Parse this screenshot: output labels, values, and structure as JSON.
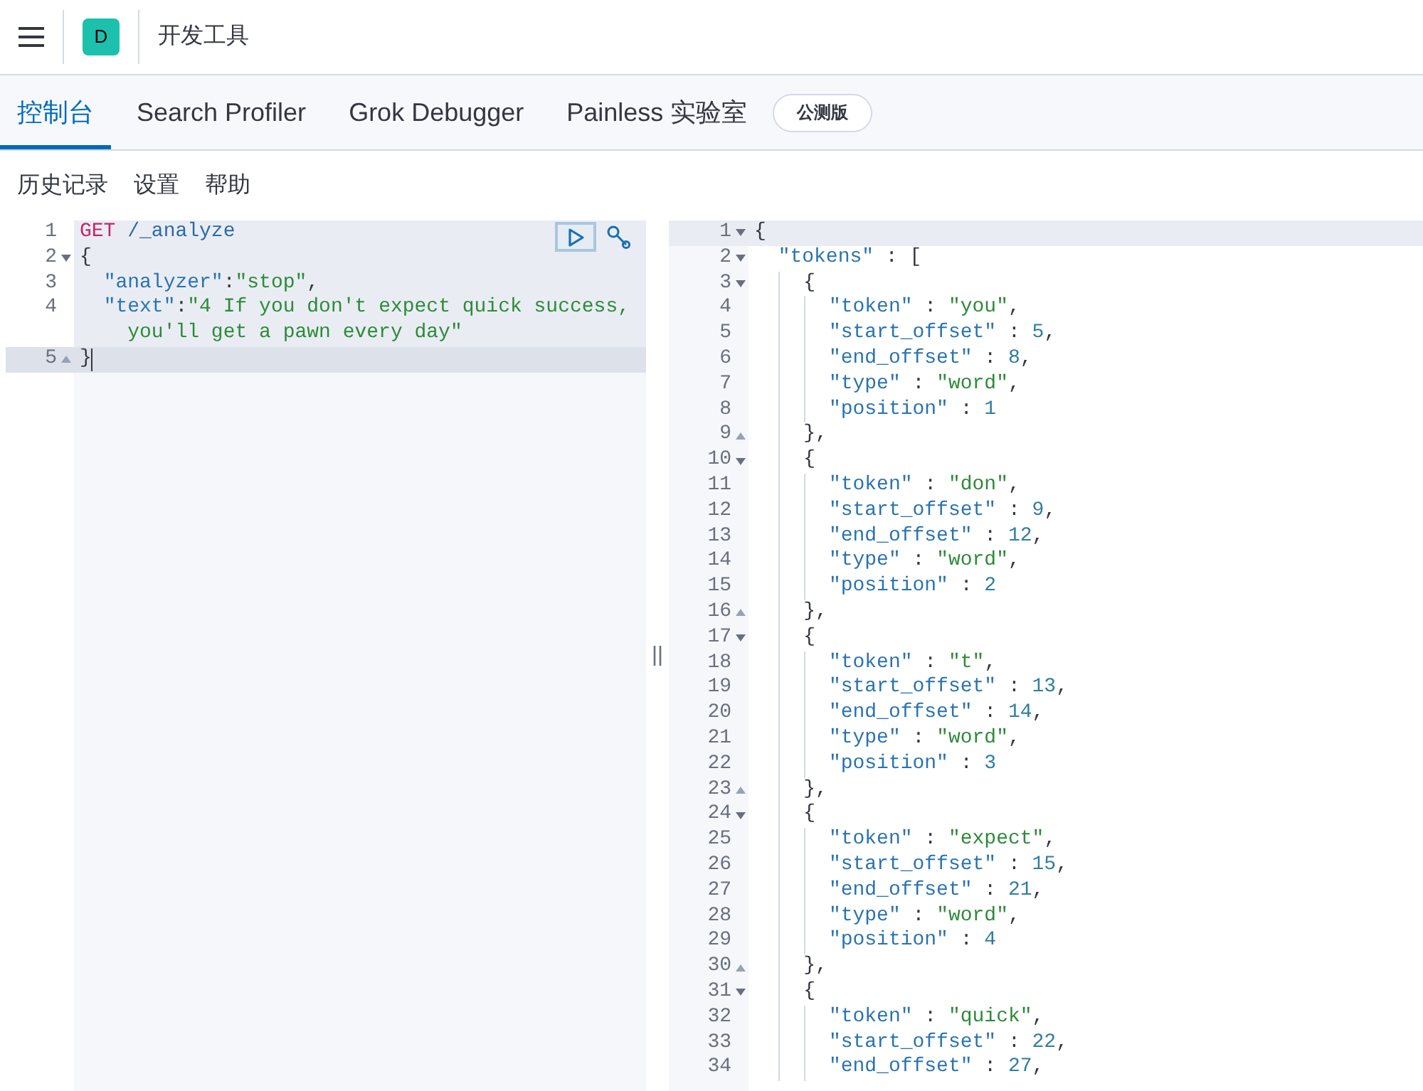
{
  "header": {
    "avatar": "D",
    "title": "开发工具"
  },
  "tabs": [
    {
      "label": "控制台",
      "selected": true
    },
    {
      "label": "Search Profiler",
      "selected": false
    },
    {
      "label": "Grok Debugger",
      "selected": false
    },
    {
      "label": "Painless 实验室",
      "selected": false,
      "badge": "公测版"
    }
  ],
  "toolbar": [
    "历史记录",
    "设置",
    "帮助"
  ],
  "request_editor": {
    "lines": [
      {
        "number": "1",
        "segments": [
          {
            "kind": "method",
            "text": "GET"
          },
          {
            "kind": "path",
            "text": " /_analyze"
          }
        ]
      },
      {
        "number": "2",
        "fold_start": true,
        "segments": [
          {
            "kind": "punct",
            "text": "{"
          }
        ]
      },
      {
        "number": "3",
        "segments": [
          {
            "kind": "key",
            "text": "  \"analyzer\""
          },
          {
            "kind": "punct",
            "text": ":"
          },
          {
            "kind": "string",
            "text": "\"stop\""
          },
          {
            "kind": "punct",
            "text": ","
          }
        ]
      },
      {
        "number": "4",
        "segments": [
          {
            "kind": "key",
            "text": "  \"text\""
          },
          {
            "kind": "punct",
            "text": ":"
          },
          {
            "kind": "string",
            "text": "\"4 If you don't expect quick success,"
          }
        ]
      },
      {
        "segments": [
          {
            "kind": "string",
            "text": "    you'll get a pawn every day\""
          }
        ]
      },
      {
        "number": "5",
        "fold_end": true,
        "active": true,
        "segments": [
          {
            "kind": "punct",
            "text": "}"
          }
        ]
      }
    ]
  },
  "response_editor": {
    "lines": [
      {
        "number": "1",
        "fold_start": true,
        "active": true,
        "segments": [
          {
            "kind": "punct",
            "text": "{"
          }
        ]
      },
      {
        "number": "2",
        "fold_start": true,
        "segments": [
          {
            "kind": "key",
            "text": "  \"tokens\""
          },
          {
            "kind": "punct",
            "text": " : ["
          }
        ]
      },
      {
        "number": "3",
        "fold_start": true,
        "segments": [
          {
            "kind": "punct",
            "text": "    {"
          }
        ]
      },
      {
        "number": "4",
        "segments": [
          {
            "kind": "key",
            "text": "      \"token\""
          },
          {
            "kind": "punct",
            "text": " : "
          },
          {
            "kind": "string",
            "text": "\"you\""
          },
          {
            "kind": "punct",
            "text": ","
          }
        ]
      },
      {
        "number": "5",
        "segments": [
          {
            "kind": "key",
            "text": "      \"start_offset\""
          },
          {
            "kind": "punct",
            "text": " : "
          },
          {
            "kind": "number",
            "text": "5"
          },
          {
            "kind": "punct",
            "text": ","
          }
        ]
      },
      {
        "number": "6",
        "segments": [
          {
            "kind": "key",
            "text": "      \"end_offset\""
          },
          {
            "kind": "punct",
            "text": " : "
          },
          {
            "kind": "number",
            "text": "8"
          },
          {
            "kind": "punct",
            "text": ","
          }
        ]
      },
      {
        "number": "7",
        "segments": [
          {
            "kind": "key",
            "text": "      \"type\""
          },
          {
            "kind": "punct",
            "text": " : "
          },
          {
            "kind": "string",
            "text": "\"word\""
          },
          {
            "kind": "punct",
            "text": ","
          }
        ]
      },
      {
        "number": "8",
        "segments": [
          {
            "kind": "key",
            "text": "      \"position\""
          },
          {
            "kind": "punct",
            "text": " : "
          },
          {
            "kind": "number",
            "text": "1"
          }
        ]
      },
      {
        "number": "9",
        "fold_end": true,
        "segments": [
          {
            "kind": "punct",
            "text": "    },"
          }
        ]
      },
      {
        "number": "10",
        "fold_start": true,
        "segments": [
          {
            "kind": "punct",
            "text": "    {"
          }
        ]
      },
      {
        "number": "11",
        "segments": [
          {
            "kind": "key",
            "text": "      \"token\""
          },
          {
            "kind": "punct",
            "text": " : "
          },
          {
            "kind": "string",
            "text": "\"don\""
          },
          {
            "kind": "punct",
            "text": ","
          }
        ]
      },
      {
        "number": "12",
        "segments": [
          {
            "kind": "key",
            "text": "      \"start_offset\""
          },
          {
            "kind": "punct",
            "text": " : "
          },
          {
            "kind": "number",
            "text": "9"
          },
          {
            "kind": "punct",
            "text": ","
          }
        ]
      },
      {
        "number": "13",
        "segments": [
          {
            "kind": "key",
            "text": "      \"end_offset\""
          },
          {
            "kind": "punct",
            "text": " : "
          },
          {
            "kind": "number",
            "text": "12"
          },
          {
            "kind": "punct",
            "text": ","
          }
        ]
      },
      {
        "number": "14",
        "segments": [
          {
            "kind": "key",
            "text": "      \"type\""
          },
          {
            "kind": "punct",
            "text": " : "
          },
          {
            "kind": "string",
            "text": "\"word\""
          },
          {
            "kind": "punct",
            "text": ","
          }
        ]
      },
      {
        "number": "15",
        "segments": [
          {
            "kind": "key",
            "text": "      \"position\""
          },
          {
            "kind": "punct",
            "text": " : "
          },
          {
            "kind": "number",
            "text": "2"
          }
        ]
      },
      {
        "number": "16",
        "fold_end": true,
        "segments": [
          {
            "kind": "punct",
            "text": "    },"
          }
        ]
      },
      {
        "number": "17",
        "fold_start": true,
        "segments": [
          {
            "kind": "punct",
            "text": "    {"
          }
        ]
      },
      {
        "number": "18",
        "segments": [
          {
            "kind": "key",
            "text": "      \"token\""
          },
          {
            "kind": "punct",
            "text": " : "
          },
          {
            "kind": "string",
            "text": "\"t\""
          },
          {
            "kind": "punct",
            "text": ","
          }
        ]
      },
      {
        "number": "19",
        "segments": [
          {
            "kind": "key",
            "text": "      \"start_offset\""
          },
          {
            "kind": "punct",
            "text": " : "
          },
          {
            "kind": "number",
            "text": "13"
          },
          {
            "kind": "punct",
            "text": ","
          }
        ]
      },
      {
        "number": "20",
        "segments": [
          {
            "kind": "key",
            "text": "      \"end_offset\""
          },
          {
            "kind": "punct",
            "text": " : "
          },
          {
            "kind": "number",
            "text": "14"
          },
          {
            "kind": "punct",
            "text": ","
          }
        ]
      },
      {
        "number": "21",
        "segments": [
          {
            "kind": "key",
            "text": "      \"type\""
          },
          {
            "kind": "punct",
            "text": " : "
          },
          {
            "kind": "string",
            "text": "\"word\""
          },
          {
            "kind": "punct",
            "text": ","
          }
        ]
      },
      {
        "number": "22",
        "segments": [
          {
            "kind": "key",
            "text": "      \"position\""
          },
          {
            "kind": "punct",
            "text": " : "
          },
          {
            "kind": "number",
            "text": "3"
          }
        ]
      },
      {
        "number": "23",
        "fold_end": true,
        "segments": [
          {
            "kind": "punct",
            "text": "    },"
          }
        ]
      },
      {
        "number": "24",
        "fold_start": true,
        "segments": [
          {
            "kind": "punct",
            "text": "    {"
          }
        ]
      },
      {
        "number": "25",
        "segments": [
          {
            "kind": "key",
            "text": "      \"token\""
          },
          {
            "kind": "punct",
            "text": " : "
          },
          {
            "kind": "string",
            "text": "\"expect\""
          },
          {
            "kind": "punct",
            "text": ","
          }
        ]
      },
      {
        "number": "26",
        "segments": [
          {
            "kind": "key",
            "text": "      \"start_offset\""
          },
          {
            "kind": "punct",
            "text": " : "
          },
          {
            "kind": "number",
            "text": "15"
          },
          {
            "kind": "punct",
            "text": ","
          }
        ]
      },
      {
        "number": "27",
        "segments": [
          {
            "kind": "key",
            "text": "      \"end_offset\""
          },
          {
            "kind": "punct",
            "text": " : "
          },
          {
            "kind": "number",
            "text": "21"
          },
          {
            "kind": "punct",
            "text": ","
          }
        ]
      },
      {
        "number": "28",
        "segments": [
          {
            "kind": "key",
            "text": "      \"type\""
          },
          {
            "kind": "punct",
            "text": " : "
          },
          {
            "kind": "string",
            "text": "\"word\""
          },
          {
            "kind": "punct",
            "text": ","
          }
        ]
      },
      {
        "number": "29",
        "segments": [
          {
            "kind": "key",
            "text": "      \"position\""
          },
          {
            "kind": "punct",
            "text": " : "
          },
          {
            "kind": "number",
            "text": "4"
          }
        ]
      },
      {
        "number": "30",
        "fold_end": true,
        "segments": [
          {
            "kind": "punct",
            "text": "    },"
          }
        ]
      },
      {
        "number": "31",
        "fold_start": true,
        "segments": [
          {
            "kind": "punct",
            "text": "    {"
          }
        ]
      },
      {
        "number": "32",
        "segments": [
          {
            "kind": "key",
            "text": "      \"token\""
          },
          {
            "kind": "punct",
            "text": " : "
          },
          {
            "kind": "string",
            "text": "\"quick\""
          },
          {
            "kind": "punct",
            "text": ","
          }
        ]
      },
      {
        "number": "33",
        "segments": [
          {
            "kind": "key",
            "text": "      \"start_offset\""
          },
          {
            "kind": "punct",
            "text": " : "
          },
          {
            "kind": "number",
            "text": "22"
          },
          {
            "kind": "punct",
            "text": ","
          }
        ]
      },
      {
        "number": "34",
        "segments": [
          {
            "kind": "key",
            "text": "      \"end_offset\""
          },
          {
            "kind": "punct",
            "text": " : "
          },
          {
            "kind": "number",
            "text": "27"
          },
          {
            "kind": "punct",
            "text": ","
          }
        ]
      }
    ]
  }
}
